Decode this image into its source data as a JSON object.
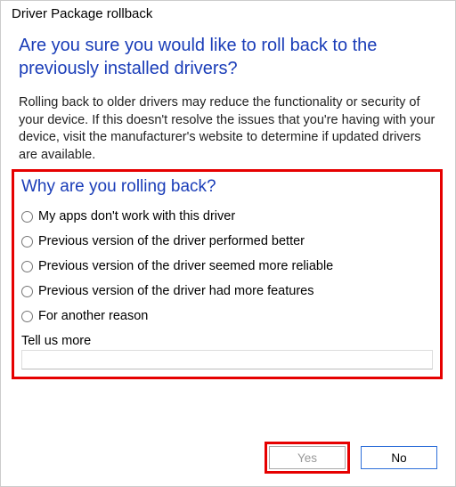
{
  "window": {
    "title": "Driver Package rollback"
  },
  "headline": "Are you sure you would like to roll back to the previously installed drivers?",
  "body": "Rolling back to older drivers may reduce the functionality or security of your device. If this doesn't resolve the issues that you're having with your device, visit the manufacturer's website to determine if updated drivers are available.",
  "survey": {
    "heading": "Why are you rolling back?",
    "options": [
      "My apps don't work with this driver",
      "Previous version of the driver performed better",
      "Previous version of the driver seemed more reliable",
      "Previous version of the driver had more features",
      "For another reason"
    ],
    "tell_more_label": "Tell us more",
    "tell_more_value": ""
  },
  "buttons": {
    "yes": "Yes",
    "no": "No"
  },
  "highlight": {
    "survey_box": true,
    "yes_button": true
  }
}
